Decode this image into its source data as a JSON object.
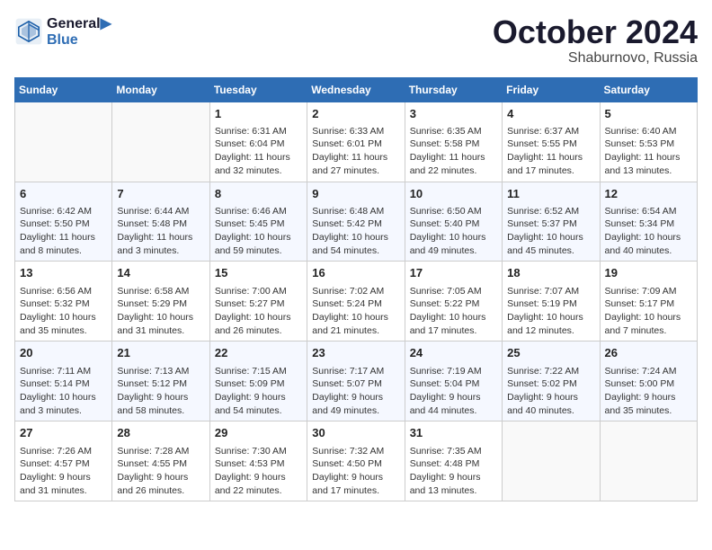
{
  "header": {
    "logo_line1": "General",
    "logo_line2": "Blue",
    "month": "October 2024",
    "location": "Shaburnovo, Russia"
  },
  "weekdays": [
    "Sunday",
    "Monday",
    "Tuesday",
    "Wednesday",
    "Thursday",
    "Friday",
    "Saturday"
  ],
  "weeks": [
    [
      {
        "day": "",
        "empty": true
      },
      {
        "day": "",
        "empty": true
      },
      {
        "day": "1",
        "sunrise": "Sunrise: 6:31 AM",
        "sunset": "Sunset: 6:04 PM",
        "daylight": "Daylight: 11 hours and 32 minutes."
      },
      {
        "day": "2",
        "sunrise": "Sunrise: 6:33 AM",
        "sunset": "Sunset: 6:01 PM",
        "daylight": "Daylight: 11 hours and 27 minutes."
      },
      {
        "day": "3",
        "sunrise": "Sunrise: 6:35 AM",
        "sunset": "Sunset: 5:58 PM",
        "daylight": "Daylight: 11 hours and 22 minutes."
      },
      {
        "day": "4",
        "sunrise": "Sunrise: 6:37 AM",
        "sunset": "Sunset: 5:55 PM",
        "daylight": "Daylight: 11 hours and 17 minutes."
      },
      {
        "day": "5",
        "sunrise": "Sunrise: 6:40 AM",
        "sunset": "Sunset: 5:53 PM",
        "daylight": "Daylight: 11 hours and 13 minutes."
      }
    ],
    [
      {
        "day": "6",
        "sunrise": "Sunrise: 6:42 AM",
        "sunset": "Sunset: 5:50 PM",
        "daylight": "Daylight: 11 hours and 8 minutes."
      },
      {
        "day": "7",
        "sunrise": "Sunrise: 6:44 AM",
        "sunset": "Sunset: 5:48 PM",
        "daylight": "Daylight: 11 hours and 3 minutes."
      },
      {
        "day": "8",
        "sunrise": "Sunrise: 6:46 AM",
        "sunset": "Sunset: 5:45 PM",
        "daylight": "Daylight: 10 hours and 59 minutes."
      },
      {
        "day": "9",
        "sunrise": "Sunrise: 6:48 AM",
        "sunset": "Sunset: 5:42 PM",
        "daylight": "Daylight: 10 hours and 54 minutes."
      },
      {
        "day": "10",
        "sunrise": "Sunrise: 6:50 AM",
        "sunset": "Sunset: 5:40 PM",
        "daylight": "Daylight: 10 hours and 49 minutes."
      },
      {
        "day": "11",
        "sunrise": "Sunrise: 6:52 AM",
        "sunset": "Sunset: 5:37 PM",
        "daylight": "Daylight: 10 hours and 45 minutes."
      },
      {
        "day": "12",
        "sunrise": "Sunrise: 6:54 AM",
        "sunset": "Sunset: 5:34 PM",
        "daylight": "Daylight: 10 hours and 40 minutes."
      }
    ],
    [
      {
        "day": "13",
        "sunrise": "Sunrise: 6:56 AM",
        "sunset": "Sunset: 5:32 PM",
        "daylight": "Daylight: 10 hours and 35 minutes."
      },
      {
        "day": "14",
        "sunrise": "Sunrise: 6:58 AM",
        "sunset": "Sunset: 5:29 PM",
        "daylight": "Daylight: 10 hours and 31 minutes."
      },
      {
        "day": "15",
        "sunrise": "Sunrise: 7:00 AM",
        "sunset": "Sunset: 5:27 PM",
        "daylight": "Daylight: 10 hours and 26 minutes."
      },
      {
        "day": "16",
        "sunrise": "Sunrise: 7:02 AM",
        "sunset": "Sunset: 5:24 PM",
        "daylight": "Daylight: 10 hours and 21 minutes."
      },
      {
        "day": "17",
        "sunrise": "Sunrise: 7:05 AM",
        "sunset": "Sunset: 5:22 PM",
        "daylight": "Daylight: 10 hours and 17 minutes."
      },
      {
        "day": "18",
        "sunrise": "Sunrise: 7:07 AM",
        "sunset": "Sunset: 5:19 PM",
        "daylight": "Daylight: 10 hours and 12 minutes."
      },
      {
        "day": "19",
        "sunrise": "Sunrise: 7:09 AM",
        "sunset": "Sunset: 5:17 PM",
        "daylight": "Daylight: 10 hours and 7 minutes."
      }
    ],
    [
      {
        "day": "20",
        "sunrise": "Sunrise: 7:11 AM",
        "sunset": "Sunset: 5:14 PM",
        "daylight": "Daylight: 10 hours and 3 minutes."
      },
      {
        "day": "21",
        "sunrise": "Sunrise: 7:13 AM",
        "sunset": "Sunset: 5:12 PM",
        "daylight": "Daylight: 9 hours and 58 minutes."
      },
      {
        "day": "22",
        "sunrise": "Sunrise: 7:15 AM",
        "sunset": "Sunset: 5:09 PM",
        "daylight": "Daylight: 9 hours and 54 minutes."
      },
      {
        "day": "23",
        "sunrise": "Sunrise: 7:17 AM",
        "sunset": "Sunset: 5:07 PM",
        "daylight": "Daylight: 9 hours and 49 minutes."
      },
      {
        "day": "24",
        "sunrise": "Sunrise: 7:19 AM",
        "sunset": "Sunset: 5:04 PM",
        "daylight": "Daylight: 9 hours and 44 minutes."
      },
      {
        "day": "25",
        "sunrise": "Sunrise: 7:22 AM",
        "sunset": "Sunset: 5:02 PM",
        "daylight": "Daylight: 9 hours and 40 minutes."
      },
      {
        "day": "26",
        "sunrise": "Sunrise: 7:24 AM",
        "sunset": "Sunset: 5:00 PM",
        "daylight": "Daylight: 9 hours and 35 minutes."
      }
    ],
    [
      {
        "day": "27",
        "sunrise": "Sunrise: 7:26 AM",
        "sunset": "Sunset: 4:57 PM",
        "daylight": "Daylight: 9 hours and 31 minutes."
      },
      {
        "day": "28",
        "sunrise": "Sunrise: 7:28 AM",
        "sunset": "Sunset: 4:55 PM",
        "daylight": "Daylight: 9 hours and 26 minutes."
      },
      {
        "day": "29",
        "sunrise": "Sunrise: 7:30 AM",
        "sunset": "Sunset: 4:53 PM",
        "daylight": "Daylight: 9 hours and 22 minutes."
      },
      {
        "day": "30",
        "sunrise": "Sunrise: 7:32 AM",
        "sunset": "Sunset: 4:50 PM",
        "daylight": "Daylight: 9 hours and 17 minutes."
      },
      {
        "day": "31",
        "sunrise": "Sunrise: 7:35 AM",
        "sunset": "Sunset: 4:48 PM",
        "daylight": "Daylight: 9 hours and 13 minutes."
      },
      {
        "day": "",
        "empty": true
      },
      {
        "day": "",
        "empty": true
      }
    ]
  ]
}
